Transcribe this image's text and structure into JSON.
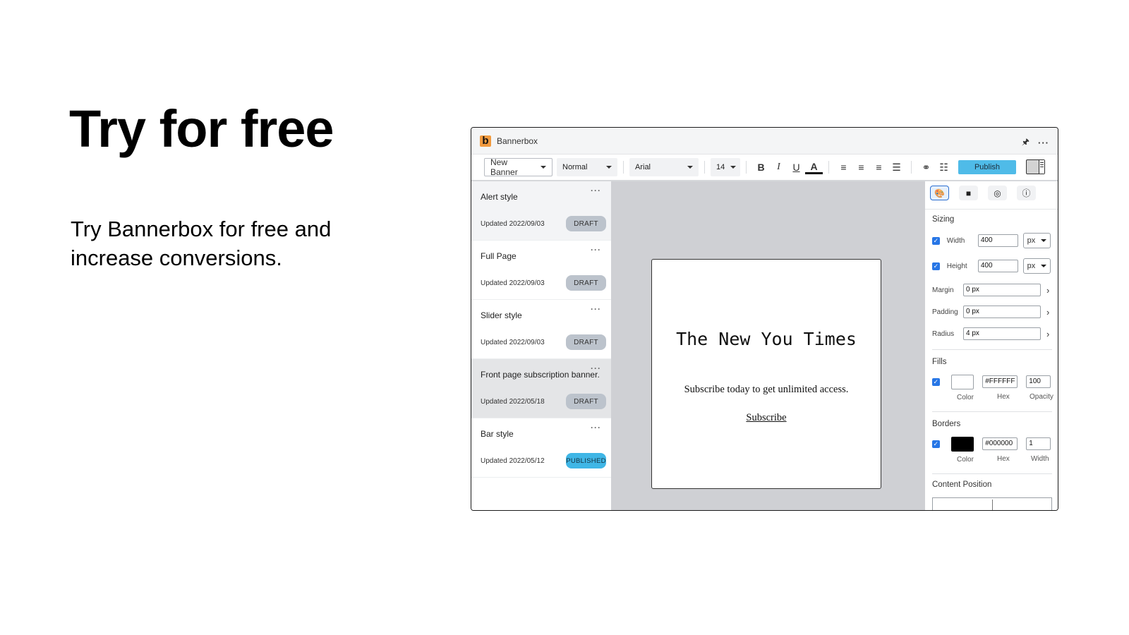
{
  "hero": {
    "title": "Try for free",
    "subtitle": "Try Bannerbox for free and increase conversions."
  },
  "app": {
    "logo_letter": "b",
    "name": "Bannerbox",
    "pin_icon": "pin-icon",
    "more_icon": "more-icon"
  },
  "toolbar": {
    "banner_select": "New Banner",
    "style_select": "Normal",
    "font_select": "Arial",
    "size_select": "14",
    "bold": "B",
    "italic": "I",
    "underline": "U",
    "text_color": "A",
    "publish_label": "Publish",
    "colors": {
      "publish_bg": "#4FBBE8"
    }
  },
  "banners": [
    {
      "name": "Alert style",
      "updated": "Updated 2022/09/03",
      "status": "DRAFT"
    },
    {
      "name": "Full Page",
      "updated": "Updated 2022/09/03",
      "status": "DRAFT"
    },
    {
      "name": "Slider style",
      "updated": "Updated 2022/09/03",
      "status": "DRAFT"
    },
    {
      "name": "Front page subscription banner.",
      "updated": "Updated 2022/05/18",
      "status": "DRAFT"
    },
    {
      "name": "Bar style",
      "updated": "Updated 2022/05/12",
      "status": "PUBLISHED"
    }
  ],
  "preview": {
    "title": "The New You Times",
    "text": "Subscribe today to get unlimited access.",
    "link": "Subscribe"
  },
  "panel": {
    "tabs": [
      "style-icon",
      "layers-icon",
      "target-icon",
      "info-icon"
    ],
    "sizing": {
      "title": "Sizing",
      "width_label": "Width",
      "width_value": "400",
      "width_unit": "px",
      "height_label": "Height",
      "height_value": "400",
      "height_unit": "px",
      "margin_label": "Margin",
      "margin_value": "0 px",
      "padding_label": "Padding",
      "padding_value": "0 px",
      "radius_label": "Radius",
      "radius_value": "4 px"
    },
    "fills": {
      "title": "Fills",
      "hex": "#FFFFFF",
      "opacity": "100",
      "color_caption": "Color",
      "hex_caption": "Hex",
      "opacity_caption": "Opacity",
      "swatch": "#FFFFFF"
    },
    "borders": {
      "title": "Borders",
      "hex": "#000000",
      "width": "1",
      "color_caption": "Color",
      "hex_caption": "Hex",
      "width_caption": "Width",
      "swatch": "#000000"
    },
    "content_position": {
      "title": "Content Position"
    }
  }
}
